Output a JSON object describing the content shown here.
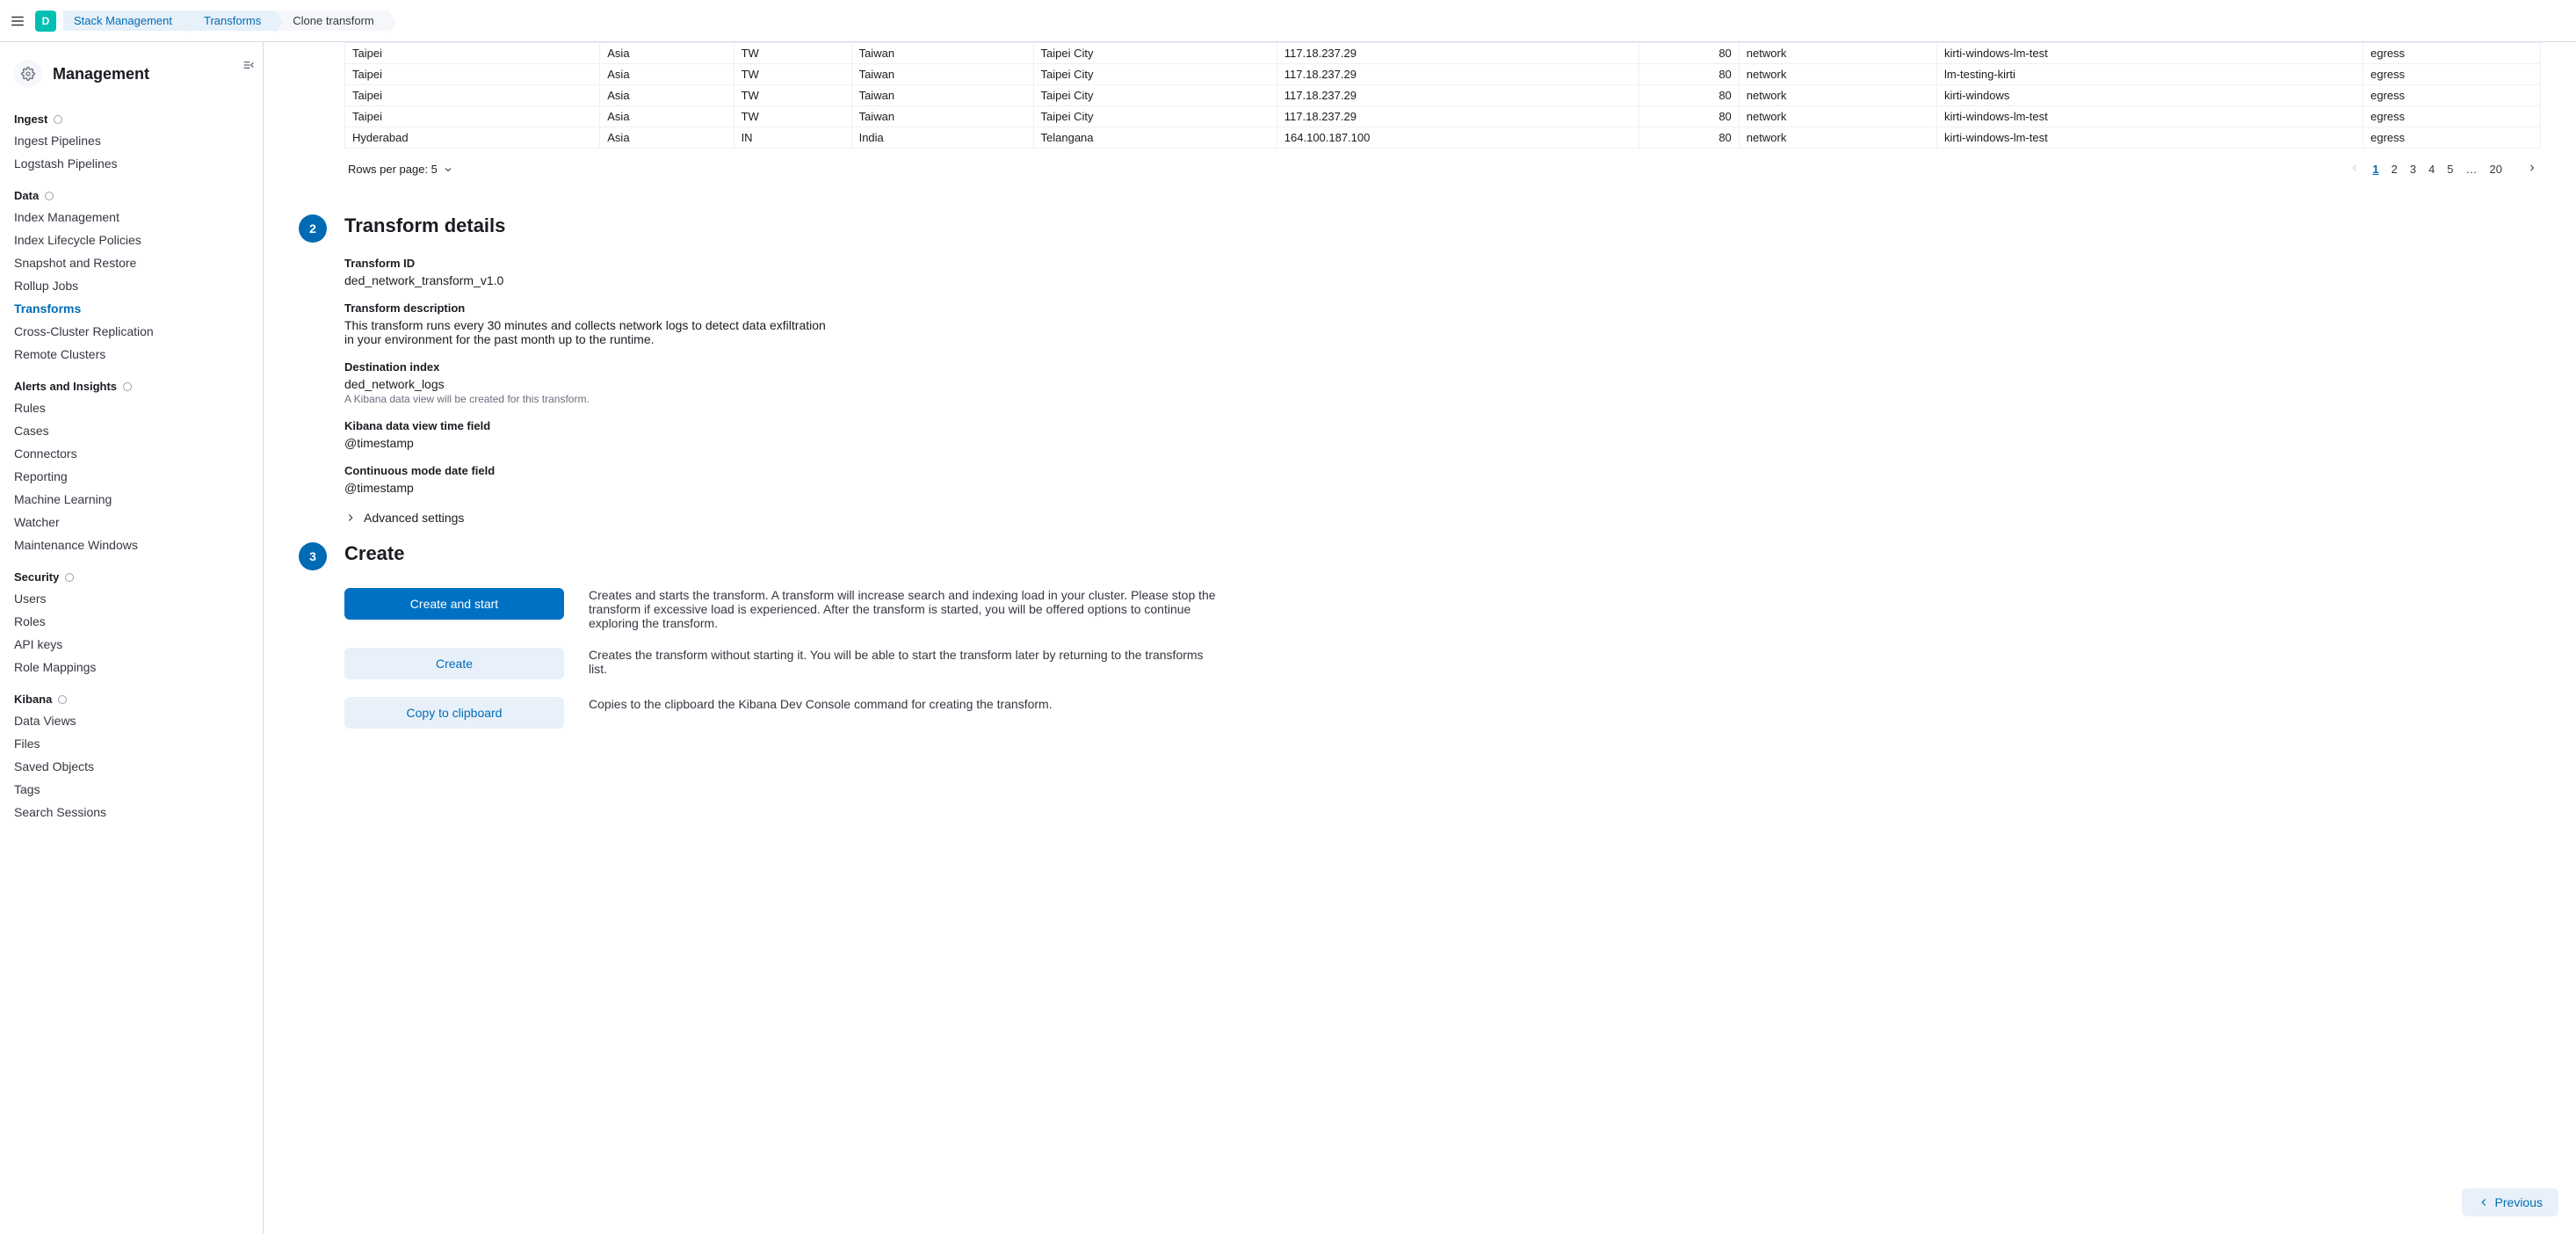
{
  "topbar": {
    "avatar_letter": "D",
    "breadcrumbs": [
      "Stack Management",
      "Transforms",
      "Clone transform"
    ]
  },
  "sidebar": {
    "title": "Management",
    "groups": [
      {
        "title": "Ingest",
        "items": [
          "Ingest Pipelines",
          "Logstash Pipelines"
        ]
      },
      {
        "title": "Data",
        "items": [
          "Index Management",
          "Index Lifecycle Policies",
          "Snapshot and Restore",
          "Rollup Jobs",
          "Transforms",
          "Cross-Cluster Replication",
          "Remote Clusters"
        ],
        "active": "Transforms"
      },
      {
        "title": "Alerts and Insights",
        "items": [
          "Rules",
          "Cases",
          "Connectors",
          "Reporting",
          "Machine Learning",
          "Watcher",
          "Maintenance Windows"
        ]
      },
      {
        "title": "Security",
        "items": [
          "Users",
          "Roles",
          "API keys",
          "Role Mappings"
        ]
      },
      {
        "title": "Kibana",
        "items": [
          "Data Views",
          "Files",
          "Saved Objects",
          "Tags",
          "Search Sessions"
        ]
      }
    ]
  },
  "table": {
    "rows": [
      [
        "Taipei",
        "Asia",
        "TW",
        "Taiwan",
        "Taipei City",
        "117.18.237.29",
        "80",
        "network",
        "kirti-windows-lm-test",
        "egress"
      ],
      [
        "Taipei",
        "Asia",
        "TW",
        "Taiwan",
        "Taipei City",
        "117.18.237.29",
        "80",
        "network",
        "lm-testing-kirti",
        "egress"
      ],
      [
        "Taipei",
        "Asia",
        "TW",
        "Taiwan",
        "Taipei City",
        "117.18.237.29",
        "80",
        "network",
        "kirti-windows",
        "egress"
      ],
      [
        "Taipei",
        "Asia",
        "TW",
        "Taiwan",
        "Taipei City",
        "117.18.237.29",
        "80",
        "network",
        "kirti-windows-lm-test",
        "egress"
      ],
      [
        "Hyderabad",
        "Asia",
        "IN",
        "India",
        "Telangana",
        "164.100.187.100",
        "80",
        "network",
        "kirti-windows-lm-test",
        "egress"
      ]
    ],
    "rows_per_page_label": "Rows per page: 5",
    "pages": [
      "1",
      "2",
      "3",
      "4",
      "5",
      "…",
      "20"
    ]
  },
  "step2": {
    "badge": "2",
    "title": "Transform details",
    "transform_id_label": "Transform ID",
    "transform_id": "ded_network_transform_v1.0",
    "desc_label": "Transform description",
    "desc": "This transform runs every 30 minutes and collects network logs to detect data exfiltration in your environment for the past month up to the runtime.",
    "dest_label": "Destination index",
    "dest": "ded_network_logs",
    "dest_help": "A Kibana data view will be created for this transform.",
    "time_label": "Kibana data view time field",
    "time": "@timestamp",
    "cont_label": "Continuous mode date field",
    "cont": "@timestamp",
    "advanced": "Advanced settings"
  },
  "step3": {
    "badge": "3",
    "title": "Create",
    "create_start_btn": "Create and start",
    "create_start_desc": "Creates and starts the transform. A transform will increase search and indexing load in your cluster. Please stop the transform if excessive load is experienced. After the transform is started, you will be offered options to continue exploring the transform.",
    "create_btn": "Create",
    "create_desc": "Creates the transform without starting it. You will be able to start the transform later by returning to the transforms list.",
    "copy_btn": "Copy to clipboard",
    "copy_desc": "Copies to the clipboard the Kibana Dev Console command for creating the transform."
  },
  "footer": {
    "previous": "Previous"
  }
}
